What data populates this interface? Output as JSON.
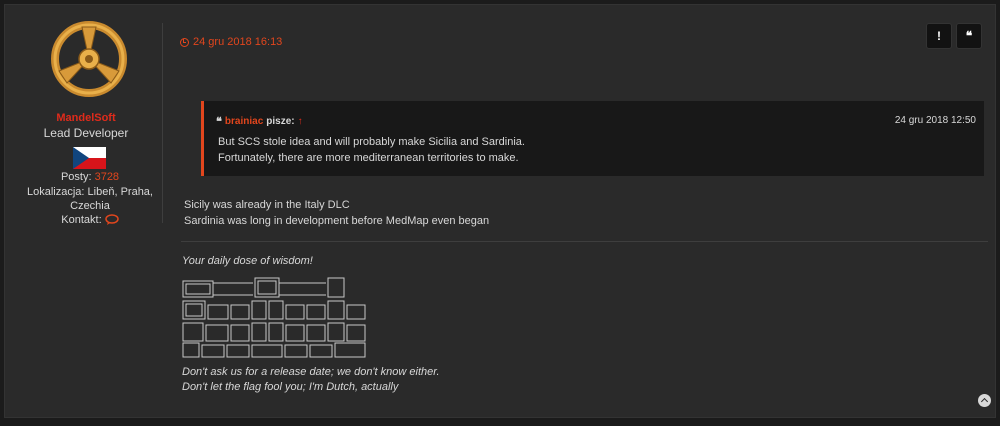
{
  "profile": {
    "username": "MandelSoft",
    "rank": "Lead Developer",
    "posts_label": "Posty:",
    "posts_count": "3728",
    "location_label": "Lokalizacja:",
    "location_line1": "Libeň, Praha,",
    "location_line2": "Czechia",
    "contact_label": "Kontakt:",
    "avatar_icon": "logo-icon",
    "flag_icon": "czech-flag-icon",
    "contact_icon": "speech-bubble-icon"
  },
  "post": {
    "date": "24 gru 2018 16:13",
    "report_label": "!",
    "quote_label": "❝",
    "quote": {
      "author": "brainiac",
      "wrote": "pisze:",
      "up_arrow": "↑",
      "date": "24 gru 2018 12:50",
      "lines": [
        "But SCS stole idea and will probably make Sicilia and Sardinia.",
        "Fortunately, there are more mediterranean territories to make."
      ]
    },
    "content_lines": [
      "Sicily was already in the Italy DLC",
      "Sardinia was long in development before MedMap even began"
    ]
  },
  "signature": {
    "line1": "Your daily dose of wisdom!",
    "line2": "Don't ask us for a release date; we don't know either.",
    "line3": "Don't let the flag fool you; I'm Dutch, actually"
  },
  "colors": {
    "accent": "#e2461d",
    "username": "#e02b1b",
    "background": "#2a2a2a"
  }
}
